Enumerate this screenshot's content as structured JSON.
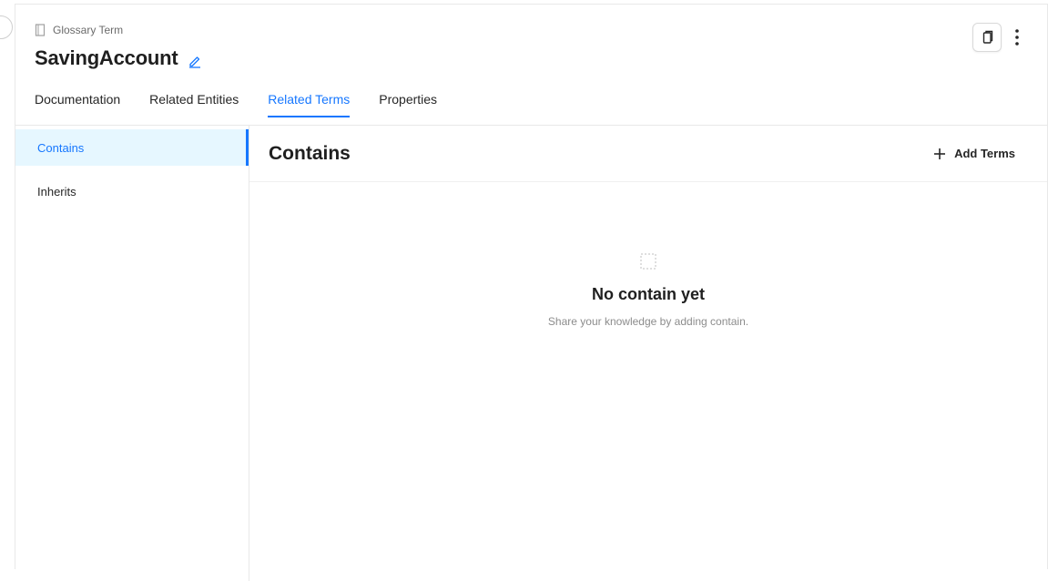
{
  "header": {
    "entity_type": "Glossary Term",
    "title": "SavingAccount"
  },
  "icons": {
    "entity_type": "document-icon",
    "edit": "pencil-icon",
    "copy": "copy-icon",
    "more": "more-vertical-icon",
    "add": "plus-icon",
    "empty": "empty-state-icon"
  },
  "tabs": [
    {
      "label": "Documentation",
      "active": false
    },
    {
      "label": "Related Entities",
      "active": false
    },
    {
      "label": "Related Terms",
      "active": true
    },
    {
      "label": "Properties",
      "active": false
    }
  ],
  "sidebar": {
    "items": [
      {
        "label": "Contains",
        "active": true
      },
      {
        "label": "Inherits",
        "active": false
      }
    ]
  },
  "content": {
    "title": "Contains",
    "add_label": "Add Terms",
    "empty_title": "No contain yet",
    "empty_desc": "Share your knowledge by adding contain."
  },
  "colors": {
    "accent": "#1677ff",
    "active_bg": "#e6f7ff",
    "border": "#e8e8e8"
  }
}
